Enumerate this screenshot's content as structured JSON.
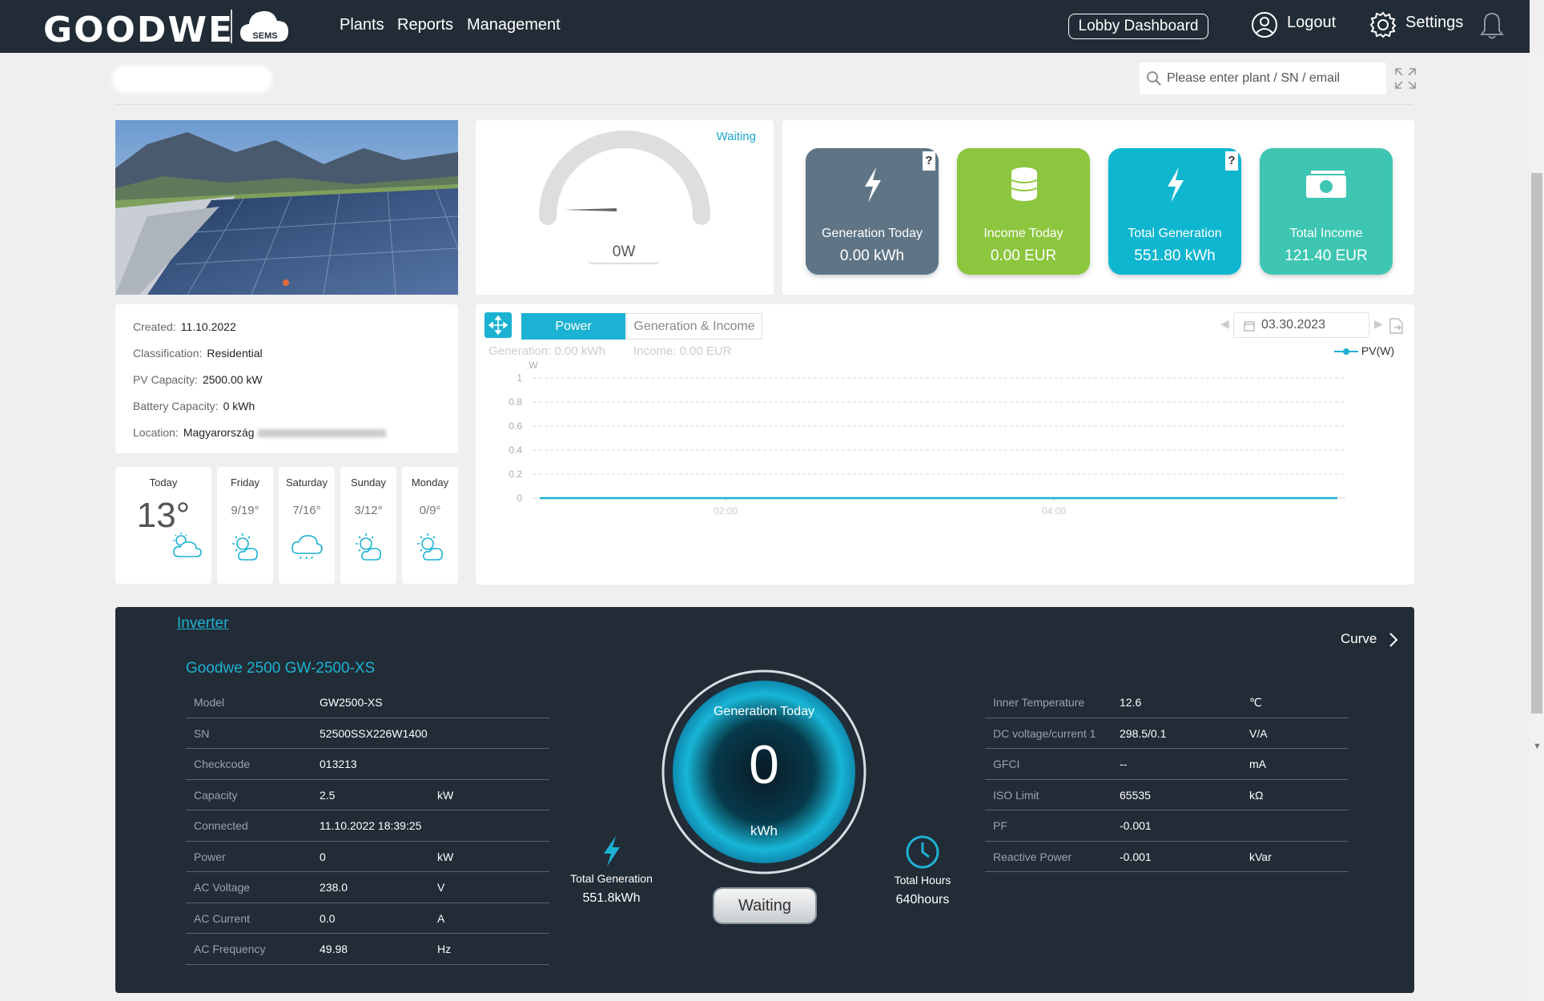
{
  "nav": {
    "logo": "GOODWE",
    "cloud_badge": "SEMS",
    "items": [
      "Plants",
      "Reports",
      "Management"
    ],
    "lobby": "Lobby Dashboard",
    "logout": "Logout",
    "settings": "Settings"
  },
  "search": {
    "placeholder": "Please enter plant / SN / email"
  },
  "gauge": {
    "status": "Waiting",
    "value": "0W"
  },
  "tiles": [
    {
      "label": "Generation Today",
      "value": "0.00 kWh",
      "color": "#5f7585",
      "icon": "lightning-icon"
    },
    {
      "label": "Income Today",
      "value": "0.00 EUR",
      "color": "#8cc63e",
      "icon": "coins-icon"
    },
    {
      "label": "Total Generation",
      "value": "551.80 kWh",
      "color": "#0fb6d0",
      "icon": "lightning-icon"
    },
    {
      "label": "Total Income",
      "value": "121.40 EUR",
      "color": "#3ec6b2",
      "icon": "money-icon"
    }
  ],
  "info": {
    "created_k": "Created:",
    "created_v": "11.10.2022",
    "class_k": "Classification:",
    "class_v": "Residential",
    "pv_k": "PV Capacity:",
    "pv_v": "2500.00 kW",
    "bat_k": "Battery Capacity:",
    "bat_v": "0 kWh",
    "loc_k": "Location:",
    "loc_v": "Magyarország"
  },
  "weather": [
    {
      "day": "Today",
      "temp": "13°",
      "icon": "partly-cloudy-icon"
    },
    {
      "day": "Friday",
      "range": "9/19°",
      "icon": "partly-sunny-icon"
    },
    {
      "day": "Saturday",
      "range": "7/16°",
      "icon": "rain-cloud-icon"
    },
    {
      "day": "Sunday",
      "range": "3/12°",
      "icon": "partly-sunny-icon"
    },
    {
      "day": "Monday",
      "range": "0/9°",
      "icon": "partly-sunny-icon"
    }
  ],
  "chart_panel": {
    "tab_power": "Power",
    "tab_gen": "Generation & Income",
    "gen_stat": "Generation: 0.00 kWh",
    "income_stat": "Income: 0.00 EUR",
    "date": "03.30.2023",
    "legend": "PV(W)"
  },
  "chart_data": {
    "type": "line",
    "ylabel": "W",
    "ylim": [
      0,
      1
    ],
    "yticks": [
      "1",
      "0.8",
      "0.6",
      "0.4",
      "0.2",
      "0"
    ],
    "xticks": [
      "02:00",
      "04:00"
    ],
    "series": [
      {
        "name": "PV(W)",
        "x": [
          "00:00",
          "05:00"
        ],
        "values": [
          0,
          0
        ],
        "color": "#1cb2d3"
      }
    ],
    "grid": true,
    "legend": "top-right"
  },
  "inverter": {
    "link": "Inverter",
    "curve": "Curve",
    "title": "Goodwe 2500 GW-2500-XS",
    "left_rows": [
      {
        "k": "Model",
        "v": "GW2500-XS",
        "u": ""
      },
      {
        "k": "SN",
        "v": "52500SSX226W1400",
        "u": ""
      },
      {
        "k": "Checkcode",
        "v": "013213",
        "u": ""
      },
      {
        "k": "Capacity",
        "v": "2.5",
        "u": "kW"
      },
      {
        "k": "Connected",
        "v": "11.10.2022 18:39:25",
        "u": ""
      },
      {
        "k": "Power",
        "v": "0",
        "u": "kW"
      },
      {
        "k": "AC Voltage",
        "v": "238.0",
        "u": "V"
      },
      {
        "k": "AC Current",
        "v": "0.0",
        "u": "A"
      },
      {
        "k": "AC Frequency",
        "v": "49.98",
        "u": "Hz"
      }
    ],
    "right_rows": [
      {
        "k": "Inner Temperature",
        "v": "12.6",
        "u": "℃"
      },
      {
        "k": "DC voltage/current 1",
        "v": "298.5/0.1",
        "u": "V/A"
      },
      {
        "k": "GFCI",
        "v": "--",
        "u": "mA"
      },
      {
        "k": "ISO Limit",
        "v": "65535",
        "u": "kΩ"
      },
      {
        "k": "PF",
        "v": "-0.001",
        "u": ""
      },
      {
        "k": "Reactive Power",
        "v": "-0.001",
        "u": "kVar"
      }
    ],
    "ring_label": "Generation Today",
    "ring_value": "0",
    "ring_unit": "kWh",
    "status": "Waiting",
    "total_gen_label": "Total Generation",
    "total_gen_value": "551.8kWh",
    "total_hours_label": "Total Hours",
    "total_hours_value": "640hours"
  }
}
